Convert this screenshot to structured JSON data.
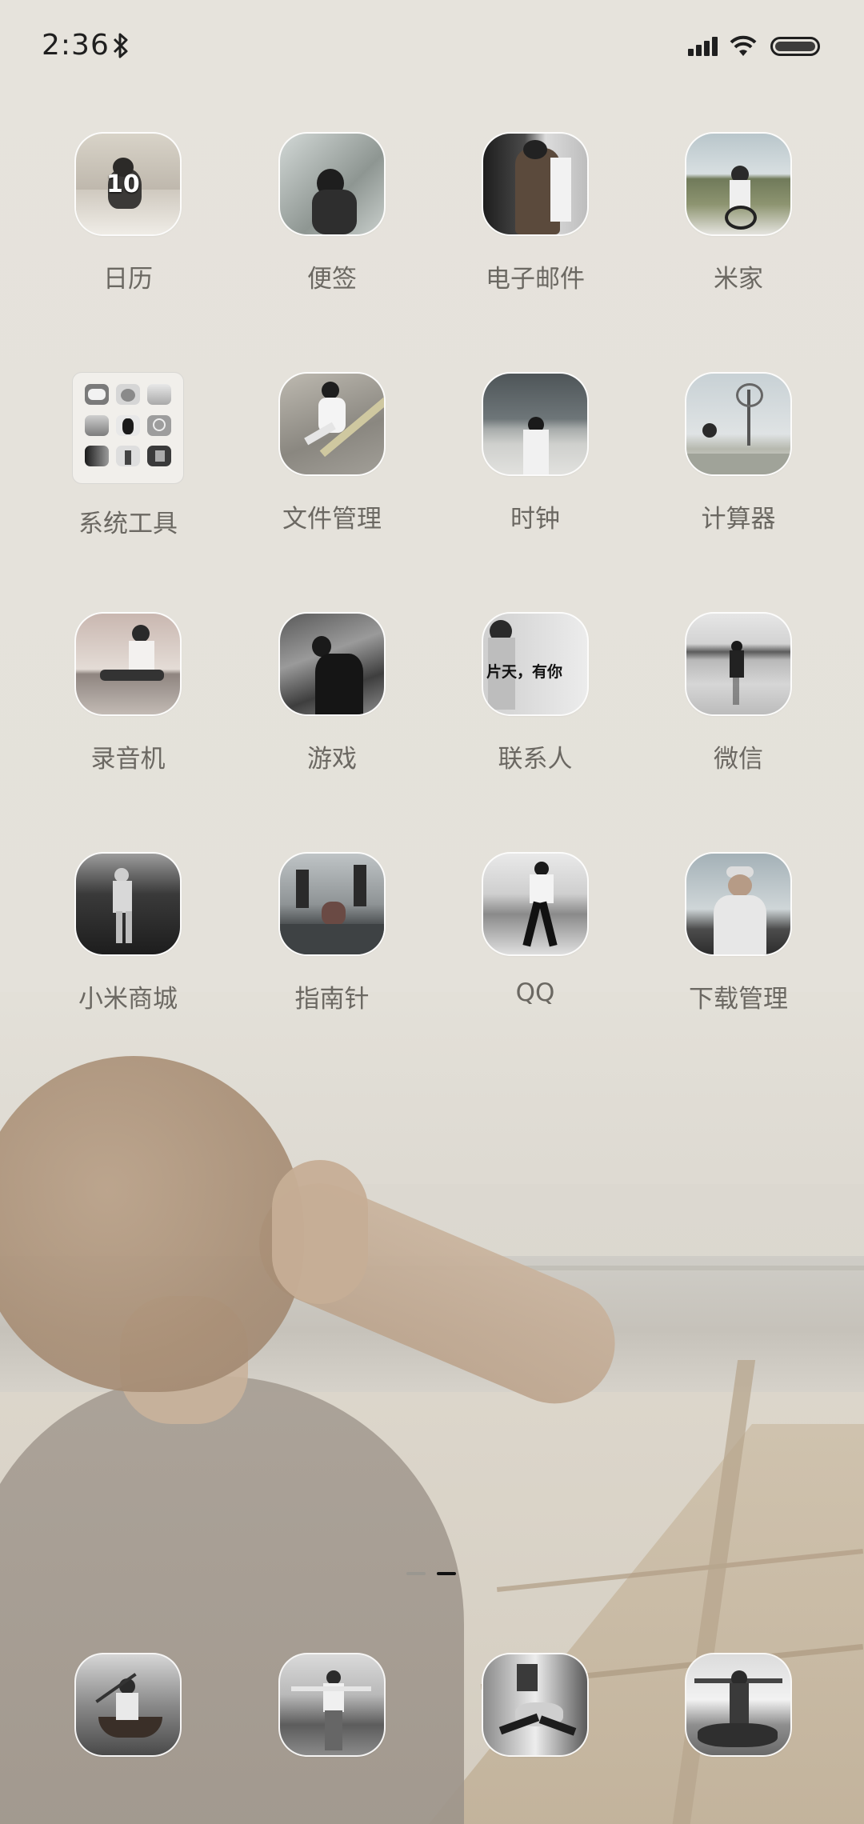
{
  "status_bar": {
    "time": "2:36",
    "icons": [
      "bluetooth-icon",
      "signal-icon",
      "wifi-icon",
      "battery-icon"
    ]
  },
  "apps": [
    {
      "label": "日历",
      "icon": "calendar-photo-icon",
      "badge_text": "10"
    },
    {
      "label": "便签",
      "icon": "notes-photo-icon"
    },
    {
      "label": "电子邮件",
      "icon": "email-photo-icon"
    },
    {
      "label": "米家",
      "icon": "mijia-photo-icon"
    },
    {
      "label": "系统工具",
      "icon": "folder-icon"
    },
    {
      "label": "文件管理",
      "icon": "file-manager-photo-icon"
    },
    {
      "label": "时钟",
      "icon": "clock-photo-icon"
    },
    {
      "label": "计算器",
      "icon": "calculator-photo-icon"
    },
    {
      "label": "录音机",
      "icon": "recorder-photo-icon"
    },
    {
      "label": "游戏",
      "icon": "games-photo-icon"
    },
    {
      "label": "联系人",
      "icon": "contacts-photo-icon",
      "icon_text": "片天，有你"
    },
    {
      "label": "微信",
      "icon": "wechat-photo-icon"
    },
    {
      "label": "小米商城",
      "icon": "mi-store-photo-icon"
    },
    {
      "label": "指南针",
      "icon": "compass-photo-icon"
    },
    {
      "label": "QQ",
      "icon": "qq-photo-icon"
    },
    {
      "label": "下载管理",
      "icon": "downloads-photo-icon"
    }
  ],
  "page_indicator": {
    "pages": 2,
    "active": 2
  },
  "dock": [
    {
      "icon": "dock-photo-icon-1"
    },
    {
      "icon": "dock-photo-icon-2"
    },
    {
      "icon": "dock-photo-icon-3"
    },
    {
      "icon": "dock-photo-icon-4"
    }
  ]
}
